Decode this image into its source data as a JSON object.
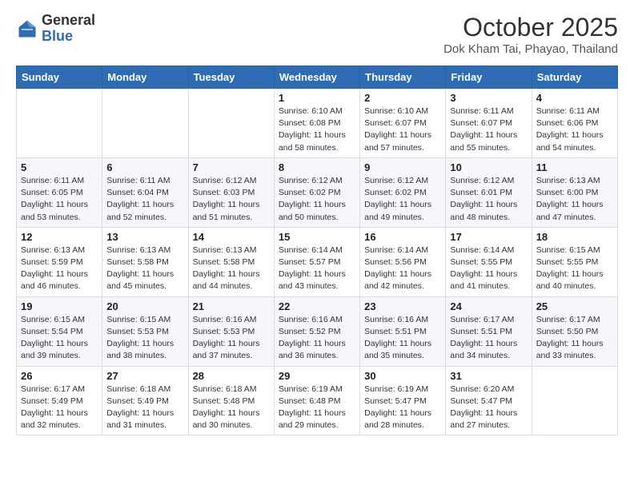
{
  "logo": {
    "general": "General",
    "blue": "Blue"
  },
  "header": {
    "month": "October 2025",
    "location": "Dok Kham Tai, Phayao, Thailand"
  },
  "weekdays": [
    "Sunday",
    "Monday",
    "Tuesday",
    "Wednesday",
    "Thursday",
    "Friday",
    "Saturday"
  ],
  "weeks": [
    [
      {
        "day": "",
        "info": ""
      },
      {
        "day": "",
        "info": ""
      },
      {
        "day": "",
        "info": ""
      },
      {
        "day": "1",
        "info": "Sunrise: 6:10 AM\nSunset: 6:08 PM\nDaylight: 11 hours\nand 58 minutes."
      },
      {
        "day": "2",
        "info": "Sunrise: 6:10 AM\nSunset: 6:07 PM\nDaylight: 11 hours\nand 57 minutes."
      },
      {
        "day": "3",
        "info": "Sunrise: 6:11 AM\nSunset: 6:07 PM\nDaylight: 11 hours\nand 55 minutes."
      },
      {
        "day": "4",
        "info": "Sunrise: 6:11 AM\nSunset: 6:06 PM\nDaylight: 11 hours\nand 54 minutes."
      }
    ],
    [
      {
        "day": "5",
        "info": "Sunrise: 6:11 AM\nSunset: 6:05 PM\nDaylight: 11 hours\nand 53 minutes."
      },
      {
        "day": "6",
        "info": "Sunrise: 6:11 AM\nSunset: 6:04 PM\nDaylight: 11 hours\nand 52 minutes."
      },
      {
        "day": "7",
        "info": "Sunrise: 6:12 AM\nSunset: 6:03 PM\nDaylight: 11 hours\nand 51 minutes."
      },
      {
        "day": "8",
        "info": "Sunrise: 6:12 AM\nSunset: 6:02 PM\nDaylight: 11 hours\nand 50 minutes."
      },
      {
        "day": "9",
        "info": "Sunrise: 6:12 AM\nSunset: 6:02 PM\nDaylight: 11 hours\nand 49 minutes."
      },
      {
        "day": "10",
        "info": "Sunrise: 6:12 AM\nSunset: 6:01 PM\nDaylight: 11 hours\nand 48 minutes."
      },
      {
        "day": "11",
        "info": "Sunrise: 6:13 AM\nSunset: 6:00 PM\nDaylight: 11 hours\nand 47 minutes."
      }
    ],
    [
      {
        "day": "12",
        "info": "Sunrise: 6:13 AM\nSunset: 5:59 PM\nDaylight: 11 hours\nand 46 minutes."
      },
      {
        "day": "13",
        "info": "Sunrise: 6:13 AM\nSunset: 5:58 PM\nDaylight: 11 hours\nand 45 minutes."
      },
      {
        "day": "14",
        "info": "Sunrise: 6:13 AM\nSunset: 5:58 PM\nDaylight: 11 hours\nand 44 minutes."
      },
      {
        "day": "15",
        "info": "Sunrise: 6:14 AM\nSunset: 5:57 PM\nDaylight: 11 hours\nand 43 minutes."
      },
      {
        "day": "16",
        "info": "Sunrise: 6:14 AM\nSunset: 5:56 PM\nDaylight: 11 hours\nand 42 minutes."
      },
      {
        "day": "17",
        "info": "Sunrise: 6:14 AM\nSunset: 5:55 PM\nDaylight: 11 hours\nand 41 minutes."
      },
      {
        "day": "18",
        "info": "Sunrise: 6:15 AM\nSunset: 5:55 PM\nDaylight: 11 hours\nand 40 minutes."
      }
    ],
    [
      {
        "day": "19",
        "info": "Sunrise: 6:15 AM\nSunset: 5:54 PM\nDaylight: 11 hours\nand 39 minutes."
      },
      {
        "day": "20",
        "info": "Sunrise: 6:15 AM\nSunset: 5:53 PM\nDaylight: 11 hours\nand 38 minutes."
      },
      {
        "day": "21",
        "info": "Sunrise: 6:16 AM\nSunset: 5:53 PM\nDaylight: 11 hours\nand 37 minutes."
      },
      {
        "day": "22",
        "info": "Sunrise: 6:16 AM\nSunset: 5:52 PM\nDaylight: 11 hours\nand 36 minutes."
      },
      {
        "day": "23",
        "info": "Sunrise: 6:16 AM\nSunset: 5:51 PM\nDaylight: 11 hours\nand 35 minutes."
      },
      {
        "day": "24",
        "info": "Sunrise: 6:17 AM\nSunset: 5:51 PM\nDaylight: 11 hours\nand 34 minutes."
      },
      {
        "day": "25",
        "info": "Sunrise: 6:17 AM\nSunset: 5:50 PM\nDaylight: 11 hours\nand 33 minutes."
      }
    ],
    [
      {
        "day": "26",
        "info": "Sunrise: 6:17 AM\nSunset: 5:49 PM\nDaylight: 11 hours\nand 32 minutes."
      },
      {
        "day": "27",
        "info": "Sunrise: 6:18 AM\nSunset: 5:49 PM\nDaylight: 11 hours\nand 31 minutes."
      },
      {
        "day": "28",
        "info": "Sunrise: 6:18 AM\nSunset: 5:48 PM\nDaylight: 11 hours\nand 30 minutes."
      },
      {
        "day": "29",
        "info": "Sunrise: 6:19 AM\nSunset: 6:48 PM\nDaylight: 11 hours\nand 29 minutes."
      },
      {
        "day": "30",
        "info": "Sunrise: 6:19 AM\nSunset: 5:47 PM\nDaylight: 11 hours\nand 28 minutes."
      },
      {
        "day": "31",
        "info": "Sunrise: 6:20 AM\nSunset: 5:47 PM\nDaylight: 11 hours\nand 27 minutes."
      },
      {
        "day": "",
        "info": ""
      }
    ]
  ]
}
